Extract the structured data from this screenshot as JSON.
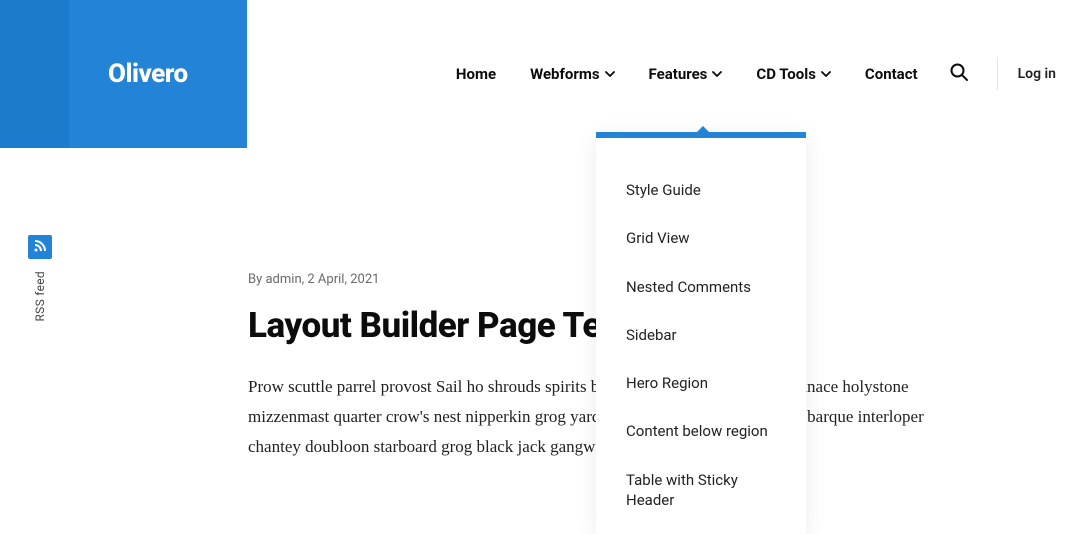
{
  "brand": "Olivero",
  "nav": {
    "items": [
      {
        "label": "Home",
        "has_submenu": false
      },
      {
        "label": "Webforms",
        "has_submenu": true
      },
      {
        "label": "Features",
        "has_submenu": true
      },
      {
        "label": "CD Tools",
        "has_submenu": true
      },
      {
        "label": "Contact",
        "has_submenu": false
      }
    ],
    "login": "Log in"
  },
  "dropdown": {
    "items": [
      "Style Guide",
      "Grid View",
      "Nested Comments",
      "Sidebar",
      "Hero Region",
      "Content below region",
      "Table with Sticky Header"
    ]
  },
  "sidebar": {
    "rss_label": "RSS feed"
  },
  "article": {
    "byline": "By admin, 2 April, 2021",
    "title": "Layout Builder Page Tes",
    "body": "Prow scuttle parrel provost Sail ho shrouds spirits boom mizzenmast yardarm. Pinnace holystone mizzenmast quarter crow's nest nipperkin grog yardarm hempen halter furl. Swab barque interloper chantey doubloon starboard grog black jack gangway rutters."
  }
}
